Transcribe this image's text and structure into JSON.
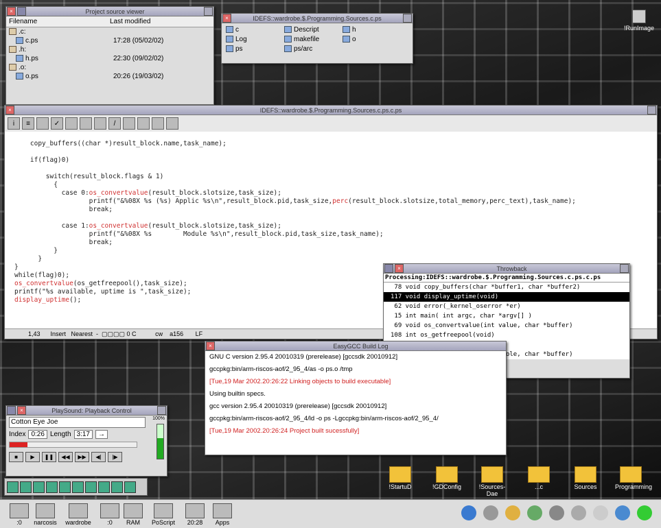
{
  "viewer": {
    "title": "Project source viewer",
    "col_filename": "Filename",
    "col_modified": "Last modified",
    "rows": [
      {
        "name": ".c:",
        "time": "",
        "dir": true
      },
      {
        "name": "c.ps",
        "time": "17:28 (05/02/02)",
        "dir": false
      },
      {
        "name": ".h:",
        "time": "",
        "dir": true
      },
      {
        "name": "h.ps",
        "time": "22:30 (09/02/02)",
        "dir": false
      },
      {
        "name": ".o:",
        "time": "",
        "dir": true
      },
      {
        "name": "o.ps",
        "time": "20:26 (19/03/02)",
        "dir": false
      }
    ]
  },
  "filer": {
    "title": "IDEFS::wardrobe.$.Programming.Sources.c.ps",
    "items": [
      "c",
      "Descript",
      "h",
      "Log",
      "makefile",
      "o",
      "ps",
      "ps/arc"
    ]
  },
  "editor": {
    "title": "IDEFS::wardrobe.$.Programming.Sources.c.ps.c.ps",
    "code_lines": [
      {
        "t": ""
      },
      {
        "t": "    copy_buffers((char *)result_block.name,task_name);"
      },
      {
        "t": ""
      },
      {
        "t": "    if(flag)0)"
      },
      {
        "t": ""
      },
      {
        "t": "        switch(result_block.flags & 1)"
      },
      {
        "t": "          {"
      },
      {
        "t": "            case 0:",
        "fn": "os_convertvalue",
        "rest": "(result_block.slotsize,task_size);"
      },
      {
        "t": "                   printf(\"&%08X %s (%s) Applic %s\\n\",result_block.pid,task_size,",
        "fn": "perc",
        "rest": "(result_block.slotsize,total_memory,perc_text),task_name);"
      },
      {
        "t": "                   break;"
      },
      {
        "t": ""
      },
      {
        "t": "            case 1:",
        "fn": "os_convertvalue",
        "rest": "(result_block.slotsize,task_size);"
      },
      {
        "t": "                   printf(\"&%08X %s        Module %s\\n\",result_block.pid,task_size,task_name);"
      },
      {
        "t": "                   break;"
      },
      {
        "t": "          }"
      },
      {
        "t": "      }"
      },
      {
        "t": "}"
      },
      {
        "t": "while(flag)0);"
      },
      {
        "t": "",
        "fn": "os_convertvalue",
        "rest": "(os_getfreepool(),task_size);"
      },
      {
        "t": "printf(\"%s available, uptime is \",task_size);"
      },
      {
        "t": "",
        "fn": "display_uptime",
        "rest": "();"
      }
    ],
    "status": "1,43      Insert   Nearest  -  ▢▢▢▢ 0 C           cw    a156       LF"
  },
  "throwback": {
    "title": "Throwback",
    "header": "Processing:IDEFS::wardrobe.$.Programming.Sources.c.ps.c.ps",
    "items": [
      " 78 void copy_buffers(char *buffer1, char *buffer2)",
      "117 void display_uptime(void)",
      " 62 void error(_kernel_oserror *er)",
      " 15 int main( int argc, char *argv[] )",
      " 69 void os_convertvalue(int value, char *buffer)",
      "108 int os_getfreepool(void)",
      " 89 int os_gettotalram(void)",
      " 97 char *perc(int part, int whole, char *buffer)"
    ],
    "selected": 1
  },
  "build": {
    "title": "EasyGCC Build Log",
    "lines": [
      {
        "t": "GNU C version 2.95.4 20010319 (prerelease) [gccsdk 20010912]",
        "red": false
      },
      {
        "t": "gccpkg:bin/arm-riscos-aof/2_95_4/as -o ps.o /tmp",
        "red": false
      },
      {
        "t": "[Tue,19 Mar 2002.20:26:22 Linking objects to build executable]",
        "red": true
      },
      {
        "t": "Using builtin specs.",
        "red": false
      },
      {
        "t": "gcc version 2.95.4 20010319 (prerelease) [gccsdk 20010912]",
        "red": false
      },
      {
        "t": "gccpkg:bin/arm-riscos-aof/2_95_4/ld -o ps -Lgccpkg:bin/arm-riscos-aof/2_95_4/",
        "red": false
      },
      {
        "t": "[Tue,19 Mar 2002.20:26:24 Project built sucessfully]",
        "red": true
      }
    ]
  },
  "play": {
    "title": "PlaySound: Playback Control",
    "track": "Cotton Eye Joe",
    "index_label": "Index",
    "index_value": "0:26",
    "length_label": "Length",
    "length_value": "3:17",
    "vol_label": "100%",
    "progress": 0.14,
    "volume": 0.6,
    "buttons": [
      "■",
      "▶",
      "❚❚",
      "◀◀",
      "▶▶",
      "◀|",
      "|▶"
    ]
  },
  "pinboard": {
    "runimage": "!RunImage",
    "folders": [
      "!StartuD",
      "!GDConfig",
      "!Sources-Dae",
      "...c",
      "Sources",
      "Programming"
    ]
  },
  "iconbar": {
    "items": [
      ":0",
      "narcosis",
      "wardrobe",
      ":0",
      "RAM",
      "PoScript",
      "20:28",
      "Apps"
    ]
  },
  "colors": {
    "red_text": "#d02020",
    "folder": "#f2c23a",
    "title_bar": "#b4b4c8"
  }
}
